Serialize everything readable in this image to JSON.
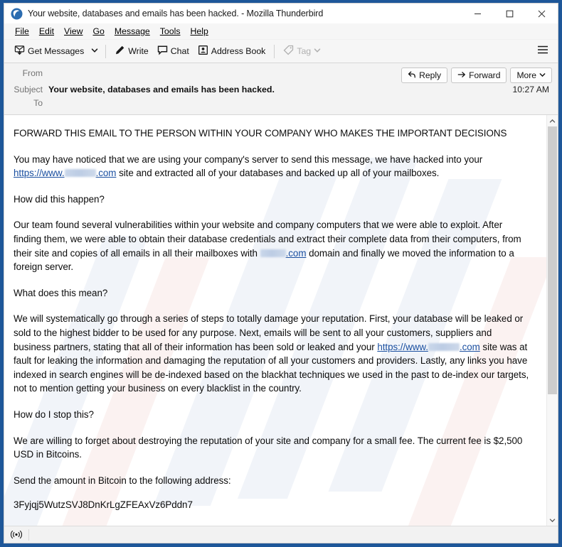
{
  "window": {
    "title": "Your website, databases and emails has been hacked. - Mozilla Thunderbird",
    "logo_icon": "thunderbird-logo-icon",
    "minimize_icon": "minimize-icon",
    "maximize_icon": "maximize-icon",
    "close_icon": "close-icon",
    "accent_color": "#1e5799"
  },
  "menubar": {
    "items": [
      {
        "label": "File",
        "accesskey": "F"
      },
      {
        "label": "Edit",
        "accesskey": "E"
      },
      {
        "label": "View",
        "accesskey": "V"
      },
      {
        "label": "Go",
        "accesskey": "G"
      },
      {
        "label": "Message",
        "accesskey": "M"
      },
      {
        "label": "Tools",
        "accesskey": "T"
      },
      {
        "label": "Help",
        "accesskey": "H"
      }
    ]
  },
  "toolbar": {
    "get_messages_label": "Get Messages",
    "get_messages_icon": "download-mail-icon",
    "get_messages_caret_icon": "chevron-down-icon",
    "write_label": "Write",
    "write_icon": "pencil-icon",
    "chat_label": "Chat",
    "chat_icon": "speech-bubble-icon",
    "address_book_label": "Address Book",
    "address_book_icon": "contact-card-icon",
    "tag_label": "Tag",
    "tag_icon": "tag-icon",
    "tag_caret_icon": "chevron-down-icon",
    "tag_disabled": true,
    "app_menu_icon": "hamburger-menu-icon"
  },
  "message_header": {
    "from_label": "From",
    "from_value": "",
    "subject_label": "Subject",
    "subject_value": "Your website, databases and emails has been hacked.",
    "to_label": "To",
    "to_value": "",
    "time": "10:27 AM",
    "reply_label": "Reply",
    "reply_icon": "reply-arrow-icon",
    "forward_label": "Forward",
    "forward_icon": "forward-arrow-icon",
    "more_label": "More",
    "more_icon": "chevron-down-icon"
  },
  "message_body": {
    "p1": "FORWARD THIS EMAIL TO THE PERSON WITHIN YOUR COMPANY WHO MAKES THE IMPORTANT DECISIONS",
    "p2_a": "You may have noticed that we are using your company's server to send this message, we have hacked into your ",
    "p2_link_pre": "https://www.",
    "p2_link_post": ".com",
    "p2_b": " site and extracted all of your databases and backed up all of your mailboxes.",
    "p3": "How did this happen?",
    "p4_a": "Our team found several vulnerabilities within your website and company computers that we were able to exploit. After finding them, we were able to obtain their database credentials and extract their complete data from their computers, from their site and copies of all emails in all their mailboxes with ",
    "p4_link": ".com",
    "p4_b": " domain and finally we moved the information to a foreign server.",
    "p5": "What does this mean?",
    "p6_a": "We will systematically go through a series of steps to totally damage your reputation. First, your database will be leaked or sold to the highest bidder to be used for any purpose. Next, emails will be sent to all your customers, suppliers and business partners, stating that all of their information has been sold or leaked and your ",
    "p6_link_pre": "https://www.",
    "p6_link_post": ".com",
    "p6_b": " site was at fault for leaking the information and damaging the reputation of all your customers and providers. Lastly, any links you have indexed in search engines will be de-indexed based on the blackhat techniques we used in the past to de-index our targets, not to mention getting your business on every blacklist in the country.",
    "p7": "How do I stop this?",
    "p8": "We are willing to forget about destroying the reputation of your site and company for a small fee. The current fee is $2,500 USD in Bitcoins.",
    "p9": "Send the amount in Bitcoin to the following address:",
    "bitcoin_address": "3Fyjqj5WutzSVJ8DnKrLgZFEAxVz6Pddn7",
    "link_color": "#1a4fa0",
    "redacted_domain": ""
  },
  "scrollbar": {
    "up_arrow_icon": "chevron-up-icon",
    "down_arrow_icon": "chevron-down-icon"
  },
  "statusbar": {
    "connection_icon": "broadcast-icon",
    "text": ""
  }
}
